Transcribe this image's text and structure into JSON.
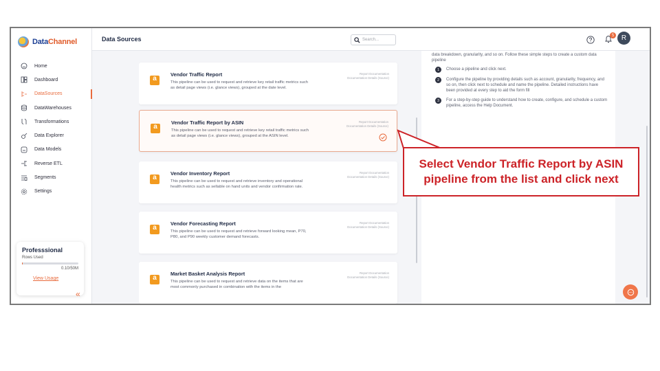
{
  "app": {
    "logo_data": "Data",
    "logo_channel": "Channel"
  },
  "sidebar": {
    "items": [
      {
        "label": "Home",
        "icon": "home-icon"
      },
      {
        "label": "Dashboard",
        "icon": "dashboard-icon"
      },
      {
        "label": "DataSources",
        "icon": "datasources-icon",
        "active": true
      },
      {
        "label": "DataWarehouses",
        "icon": "database-icon"
      },
      {
        "label": "Transformations",
        "icon": "transform-icon"
      },
      {
        "label": "Data Explorer",
        "icon": "explorer-icon"
      },
      {
        "label": "Data Models",
        "icon": "models-icon"
      },
      {
        "label": "Reverse ETL",
        "icon": "reverse-etl-icon"
      },
      {
        "label": "Segments",
        "icon": "segments-icon"
      },
      {
        "label": "Settings",
        "icon": "settings-icon"
      }
    ],
    "plan": {
      "name": "Professsional",
      "rows_label": "Rows Used",
      "usage": "0.10/50M",
      "usage_fraction": 0.002,
      "link": "View Usage"
    },
    "collapse_glyph": "«"
  },
  "header": {
    "title": "Data Sources",
    "search_placeholder": "Search...",
    "notification_count": "5",
    "avatar_initial": "R"
  },
  "pipelines": [
    {
      "title": "Vendor Traffic Report",
      "description": "This pipeline can be used to request and retrieve key retail traffic metrics such as detail page views (i.e. glance views), grouped at the date level.",
      "doc_link": "Report Documentation",
      "doc_source": "Documentation Details (Source)",
      "selected": false
    },
    {
      "title": "Vendor Traffic Report by ASIN",
      "description": "This pipeline can be used to request and retrieve key retail traffic metrics such as detail page views (i.e. glance views), grouped at the ASIN level.",
      "doc_link": "Report Documentation",
      "doc_source": "Documentation Details (Source)",
      "selected": true
    },
    {
      "title": "Vendor Inventory Report",
      "description": "This pipeline can be used to request and retrieve inventory and operational health metrics such as sellable on hand units and vendor confirmation rate.",
      "doc_link": "Report Documentation",
      "doc_source": "Documentation Details (Source)",
      "selected": false
    },
    {
      "title": "Vendor Forecasting Report",
      "description": "This pipeline can be used to request and retrieve forward looking mean, P70, P80, and P90 weekly customer demand forecasts.",
      "doc_link": "Report Documentation",
      "doc_source": "Documentation Details (Source)",
      "selected": false
    },
    {
      "title": "Market Basket Analysis Report",
      "description": "This pipeline can be used to request and retrieve data on the items that are most commonly purchased in combination with the items in the",
      "doc_link": "Report Documentation",
      "doc_source": "Documentation Details (Source)",
      "selected": false
    }
  ],
  "guide": {
    "intro": "data breakdown, granularity, and so on. Follow these simple steps to create a custom data pipeline",
    "steps": [
      {
        "num": "1",
        "text": "Choose a pipeline and click next."
      },
      {
        "num": "2",
        "text": "Configure the pipeline by providing details such as account, granularity, frequency, and so on, then click next to schedule and name the pipeline. Detailed instructions have been provided at every step to aid the form fill"
      },
      {
        "num": "3",
        "text": "For a step-by-step guide to understand how to create, configure, and schedule a custom pipeline, access the Help Document."
      }
    ]
  },
  "callout": {
    "text": "Select Vendor Traffic Report by ASIN pipeline from the list and click next",
    "color": "#cc2227"
  },
  "colors": {
    "accent": "#e86a3c",
    "amazon": "#f29a1f"
  }
}
